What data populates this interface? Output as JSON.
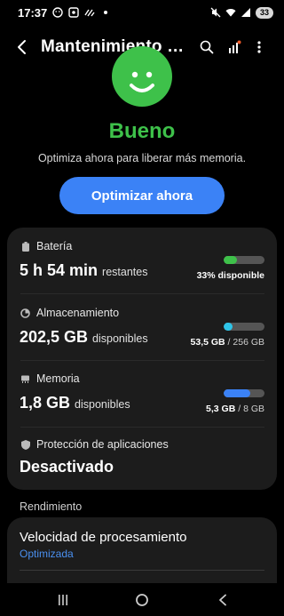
{
  "status_bar": {
    "time": "17:37",
    "left_icons": [
      "face-icon",
      "screenshot-icon",
      "screen-recorder-icon",
      "dot-icon"
    ],
    "right_icons": [
      "mute-icon",
      "wifi-icon",
      "signal-icon"
    ],
    "battery_percent": "33"
  },
  "header": {
    "title": "Mantenimiento del dispositivo",
    "icons": [
      "back-icon",
      "search-icon",
      "signal-notification-icon",
      "more-options-icon"
    ]
  },
  "summary": {
    "status": "Bueno",
    "description": "Optimiza ahora para liberar más memoria.",
    "button_label": "Optimizar ahora",
    "status_color": "#3ec14a"
  },
  "items": [
    {
      "label": "Batería",
      "icon": "battery-icon",
      "value": "5 h 54 min",
      "value_suffix": "restantes",
      "detail": "33% disponible",
      "level": 0.33,
      "color": "#3ec14a"
    },
    {
      "label": "Almacenamiento",
      "icon": "storage-icon",
      "value": "202,5 GB",
      "value_suffix": "disponibles",
      "detail_used": "53,5 GB",
      "detail_sep": " / ",
      "detail_total": "256 GB",
      "level": 0.21,
      "color": "#2ec4e8"
    },
    {
      "label": "Memoria",
      "icon": "memory-icon",
      "value": "1,8 GB",
      "value_suffix": "disponibles",
      "detail_used": "5,3 GB",
      "detail_sep": " / ",
      "detail_total": "8 GB",
      "level": 0.66,
      "color": "#3b82f6"
    },
    {
      "label": "Protección de aplicaciones",
      "icon": "shield-icon",
      "value": "Desactivado"
    }
  ],
  "performance": {
    "section_label": "Rendimiento",
    "speed_title": "Velocidad de procesamiento",
    "speed_value": "Optimizada",
    "accent": "#4a90f0"
  },
  "nav_bar": [
    "recents-icon",
    "home-icon",
    "back-icon"
  ]
}
